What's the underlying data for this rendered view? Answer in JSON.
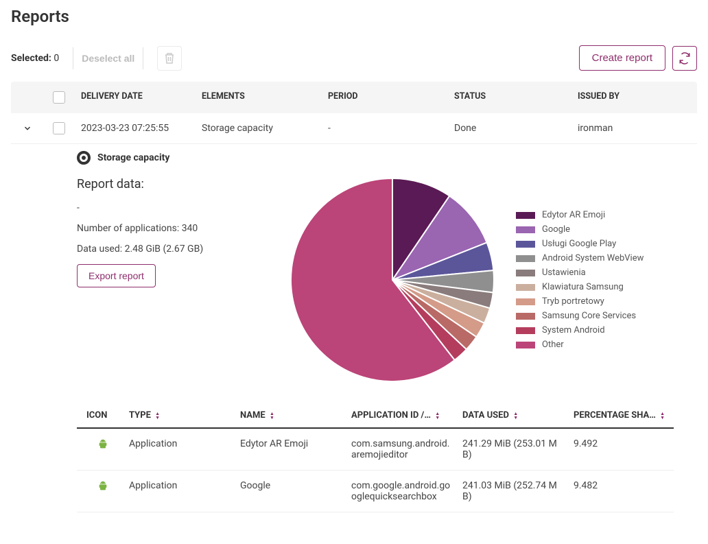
{
  "page_title": "Reports",
  "toolbar": {
    "selected_label": "Selected:",
    "selected_count": "0",
    "deselect_label": "Deselect all",
    "create_report_label": "Create report"
  },
  "main_table": {
    "headers": {
      "delivery_date": "DELIVERY DATE",
      "elements": "ELEMENTS",
      "period": "PERIOD",
      "status": "STATUS",
      "issued_by": "ISSUED BY"
    },
    "rows": [
      {
        "delivery_date": "2023-03-23 07:25:55",
        "elements": "Storage capacity",
        "period": "-",
        "status": "Done",
        "issued_by": "ironman"
      }
    ]
  },
  "expanded": {
    "radio_label": "Storage capacity",
    "report_data_title": "Report data:",
    "line_dash": "-",
    "num_apps_label": "Number of applications: 340",
    "data_used_label": "Data used: 2.48 GiB (2.67 GB)",
    "export_label": "Export report"
  },
  "chart_data": {
    "type": "pie",
    "title": "",
    "series": [
      {
        "name": "Edytor AR Emoji",
        "value": 9.5,
        "color": "#5a1a55"
      },
      {
        "name": "Google",
        "value": 9.5,
        "color": "#9a65b1"
      },
      {
        "name": "Usługi Google Play",
        "value": 4.5,
        "color": "#5b569a"
      },
      {
        "name": "Android System WebView",
        "value": 3.5,
        "color": "#8f8f8f"
      },
      {
        "name": "Ustawienia",
        "value": 2.5,
        "color": "#8a7c7c"
      },
      {
        "name": "Klawiatura Samsung",
        "value": 2.5,
        "color": "#cbaf9e"
      },
      {
        "name": "Tryb portretowy",
        "value": 2.5,
        "color": "#d49b88"
      },
      {
        "name": "Samsung Core Services",
        "value": 2.5,
        "color": "#b96a66"
      },
      {
        "name": "System Android",
        "value": 2.5,
        "color": "#b43d5d"
      },
      {
        "name": "Other",
        "value": 60.5,
        "color": "#bb4478"
      }
    ]
  },
  "data_table": {
    "headers": {
      "icon": "ICON",
      "type": "TYPE",
      "name": "NAME",
      "app_id": "APPLICATION ID /…",
      "data_used": "DATA USED",
      "pct": "PERCENTAGE SHA…"
    },
    "rows": [
      {
        "type": "Application",
        "name": "Edytor AR Emoji",
        "app_id": "com.samsung.android.aremojieditor",
        "data_used": "241.29 MiB (253.01 MB)",
        "pct": "9.492"
      },
      {
        "type": "Application",
        "name": "Google",
        "app_id": "com.google.android.googlequicksearchbox",
        "data_used": "241.03 MiB (252.74 MB)",
        "pct": "9.482"
      }
    ]
  }
}
